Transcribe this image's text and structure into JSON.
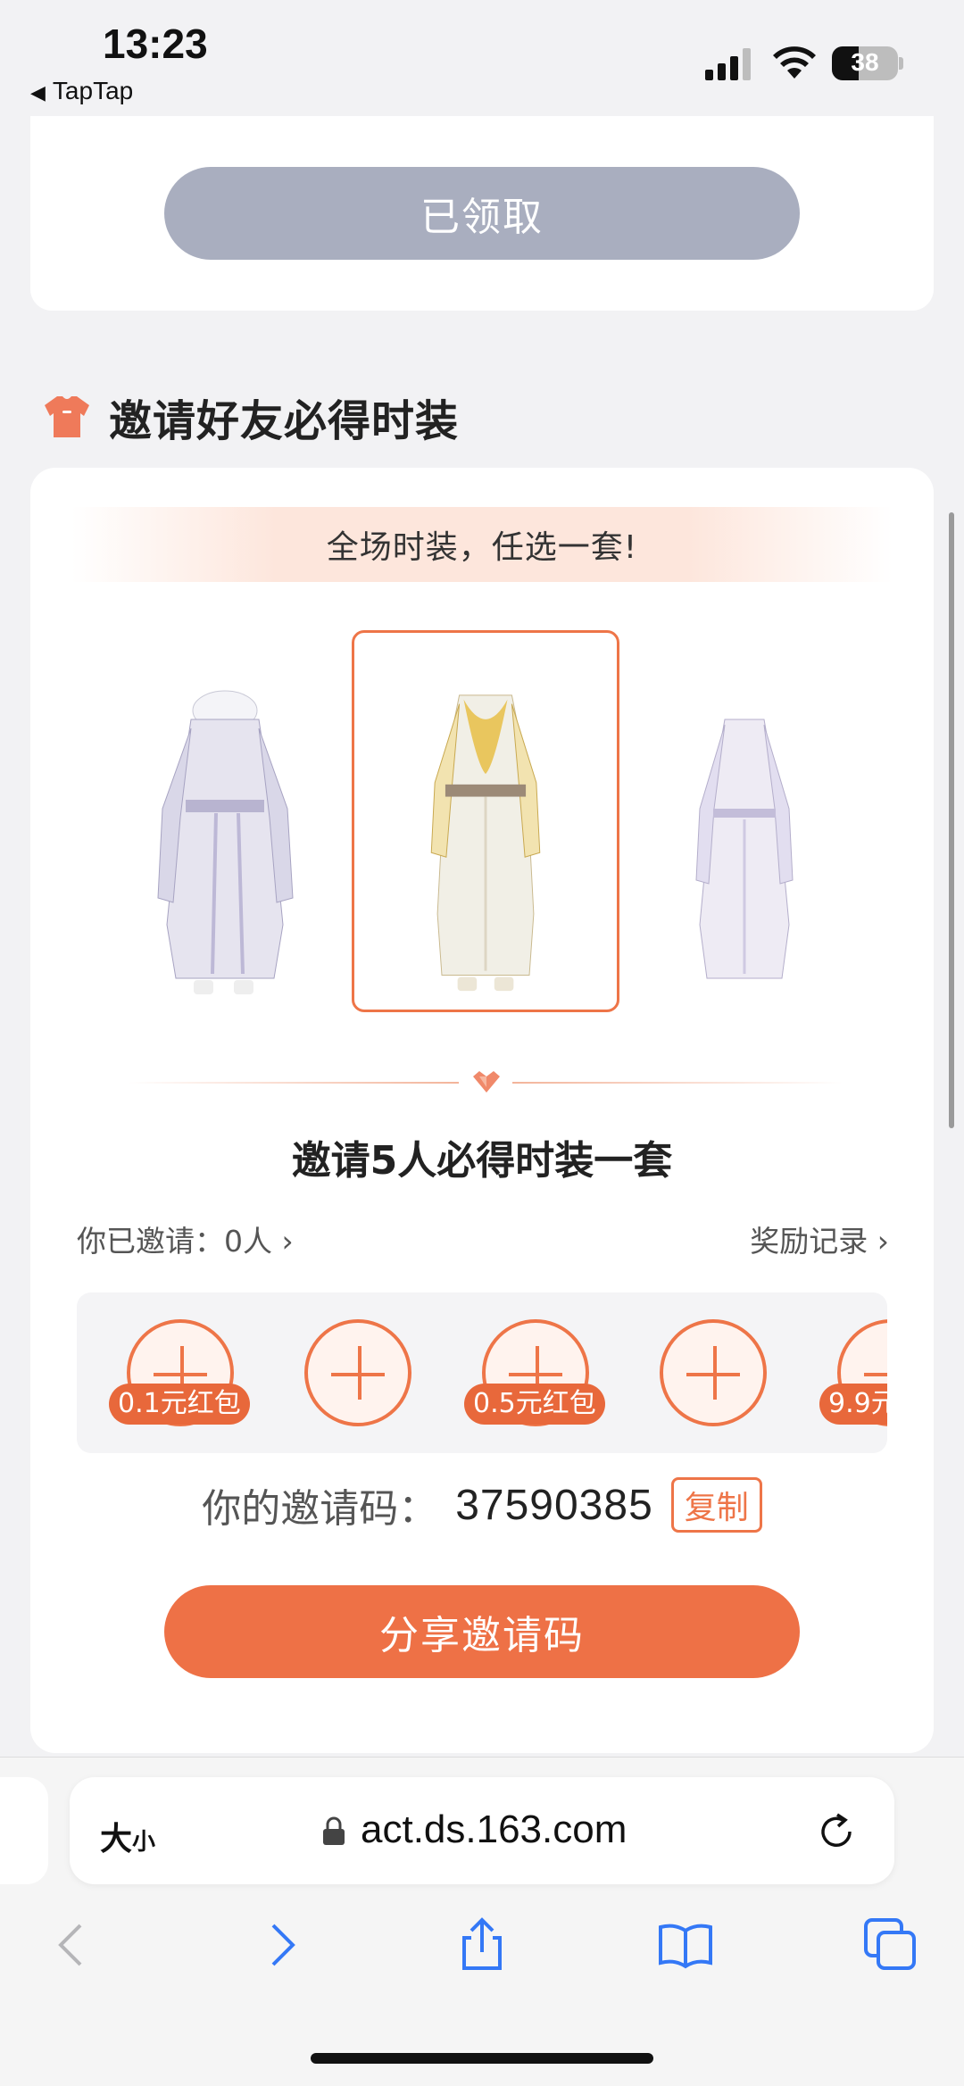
{
  "status_bar": {
    "time": "13:23",
    "back_app": "TapTap",
    "battery": "38"
  },
  "top_card": {
    "claimed_label": "已领取"
  },
  "section": {
    "title": "邀请好友必得时装"
  },
  "main_card": {
    "banner": "全场时装，任选一套!",
    "outfits": [
      {
        "name": "white-purple-outfit",
        "selected": false
      },
      {
        "name": "gold-white-outfit",
        "selected": true
      },
      {
        "name": "lavender-outfit",
        "selected": false
      }
    ],
    "goal": "邀请5人必得时装一套",
    "invited_label": "你已邀请：0人",
    "records_label": "奖励记录",
    "slots": [
      {
        "tag": "0.1元红包"
      },
      {
        "tag": ""
      },
      {
        "tag": "0.5元红包"
      },
      {
        "tag": ""
      },
      {
        "tag": "9.9元"
      }
    ],
    "code_label": "你的邀请码：",
    "code_value": "37590385",
    "copy_label": "复制",
    "share_label": "分享邀请码"
  },
  "browser": {
    "text_size_label": "大",
    "text_size_small": "小",
    "url": "act.ds.163.com"
  },
  "colors": {
    "accent": "#ee7548",
    "claimed_bg": "#a9aebf",
    "ios_blue": "#3478f6"
  }
}
